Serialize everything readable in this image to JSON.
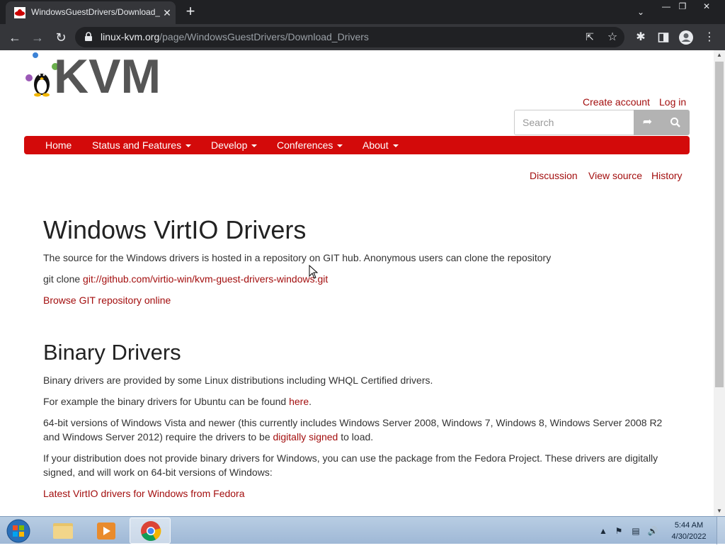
{
  "browser": {
    "tab_title": "WindowsGuestDrivers/Download_Drivers",
    "tab_close": "✕",
    "new_tab": "+",
    "url_host": "linux-kvm.org",
    "url_path": "/page/WindowsGuestDrivers/Download_Drivers"
  },
  "site": {
    "logo_text": "KVM",
    "create_account": "Create account",
    "log_in": "Log in",
    "search_placeholder": "Search",
    "nav": [
      {
        "label": "Home",
        "dropdown": false
      },
      {
        "label": "Status and Features",
        "dropdown": true
      },
      {
        "label": "Develop",
        "dropdown": true
      },
      {
        "label": "Conferences",
        "dropdown": true
      },
      {
        "label": "About",
        "dropdown": true
      }
    ],
    "page_tabs": [
      "Discussion",
      "View source",
      "History"
    ]
  },
  "content": {
    "heading1": "Windows VirtIO Drivers",
    "p1": "The source for the Windows drivers is hosted in a repository on GIT hub. Anonymous users can clone the repository",
    "git_clone_prefix": "git clone ",
    "git_clone_url": "git://github.com/virtio-win/kvm-guest-drivers-windows.git",
    "browse_link": "Browse GIT repository online",
    "heading2": "Binary Drivers",
    "p2": "Binary drivers are provided by some Linux distributions including WHQL Certified drivers.",
    "p3_prefix": "For example the binary drivers for Ubuntu can be found ",
    "p3_link": "here",
    "p3_suffix": ".",
    "p4_prefix": "64-bit versions of Windows Vista and newer (this currently includes Windows Server 2008, Windows 7, Windows 8, Windows Server 2008 R2 and Windows Server 2012) require the drivers to be ",
    "p4_link": "digitally signed",
    "p4_suffix": " to load.",
    "p5": "If your distribution does not provide binary drivers for Windows, you can use the package from the Fedora Project. These drivers are digitally signed, and will work on 64-bit versions of Windows:",
    "fedora_link": "Latest VirtIO drivers for Windows from Fedora"
  },
  "taskbar": {
    "time": "5:44 AM",
    "date": "4/30/2022"
  },
  "colors": {
    "link": "#a30e0e",
    "navbar": "#d30a0a",
    "chrome_dark": "#202124"
  }
}
